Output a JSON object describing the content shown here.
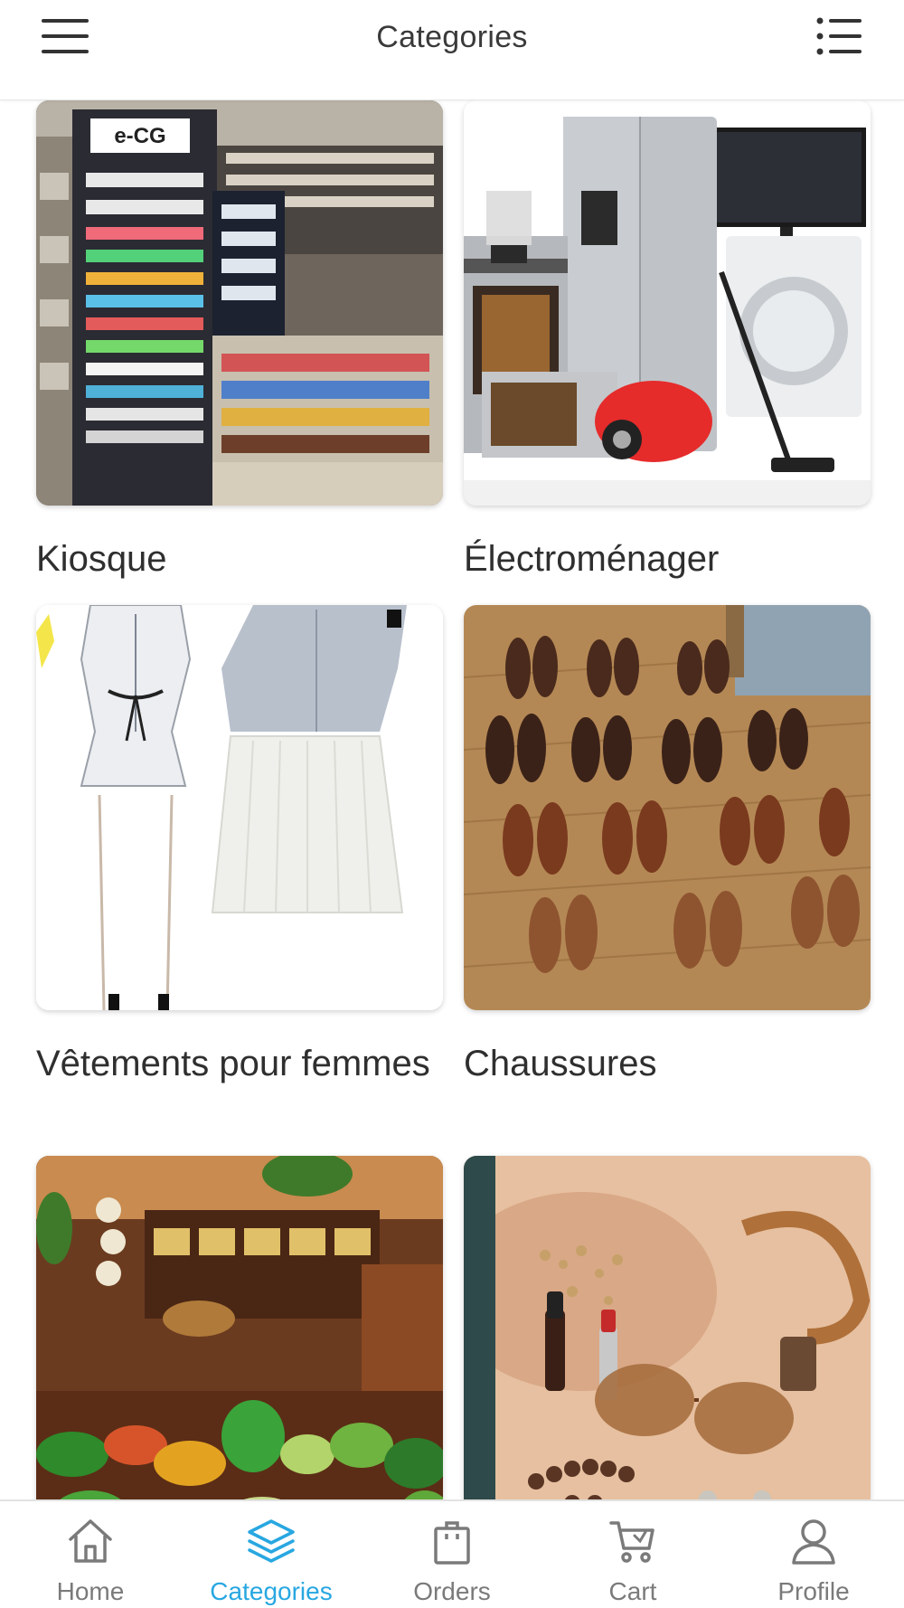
{
  "header": {
    "title": "Categories",
    "menu_icon": "hamburger-menu-icon",
    "list_icon": "list-view-icon"
  },
  "categories": [
    {
      "label": "Kiosque",
      "image": "kiosk-store-photo"
    },
    {
      "label": "Électroménager",
      "image": "home-appliances-photo"
    },
    {
      "label": "Vêtements pour femmes",
      "image": "women-dress-photo"
    },
    {
      "label": "Chaussures",
      "image": "shoes-photo"
    },
    {
      "label": "",
      "image": "grocery-market-photo"
    },
    {
      "label": "",
      "image": "accessories-jewelry-photo"
    }
  ],
  "bottom_nav": {
    "active": "Categories",
    "items": [
      {
        "label": "Home",
        "icon": "home-icon"
      },
      {
        "label": "Categories",
        "icon": "layers-icon"
      },
      {
        "label": "Orders",
        "icon": "shopping-bag-icon"
      },
      {
        "label": "Cart",
        "icon": "cart-icon"
      },
      {
        "label": "Profile",
        "icon": "user-icon"
      }
    ]
  },
  "colors": {
    "accent": "#28a7e1",
    "inactive": "#7a7a7a",
    "text": "#2f2f2f"
  }
}
